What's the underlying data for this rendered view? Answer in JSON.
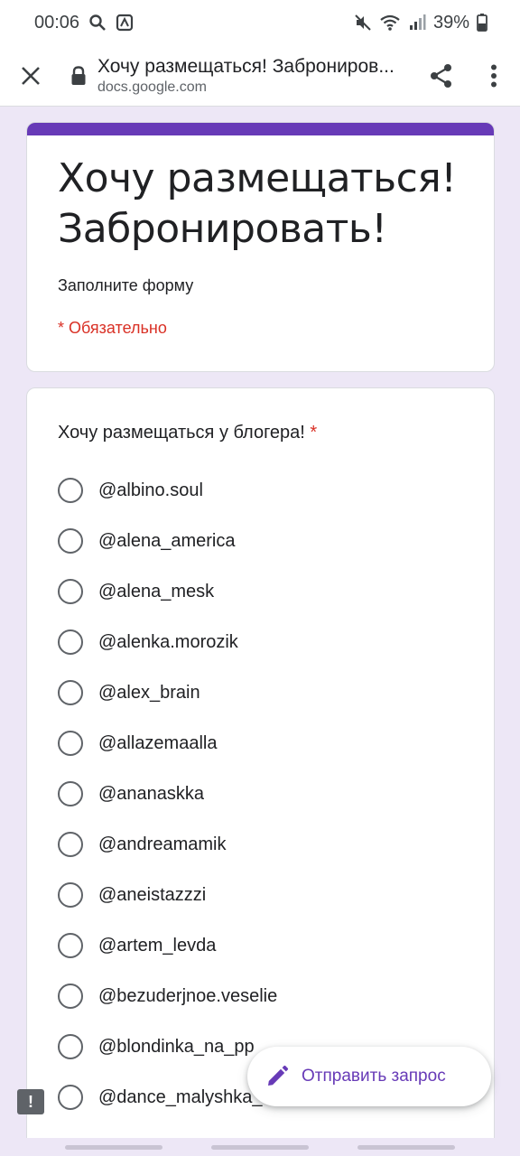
{
  "status_bar": {
    "time": "00:06",
    "battery": "39%",
    "icons": [
      "search-icon",
      "app-notification-icon",
      "mute-icon",
      "wifi-icon",
      "signal-icon",
      "battery-icon"
    ]
  },
  "tab": {
    "title": "Хочу размещаться! Заброниров...",
    "url": "docs.google.com",
    "icons": [
      "close-icon",
      "lock-icon",
      "share-icon",
      "more-vert-icon"
    ]
  },
  "form": {
    "title": "Хочу размещаться! Забронировать!",
    "description": "Заполните форму",
    "required_note": "* Обязательно",
    "accent_color": "#673ab7",
    "question": "Хочу размещаться у блогера!",
    "question_required_mark": "*",
    "options": [
      "@albino.soul",
      "@alena_america",
      "@alena_mesk",
      "@alenka.morozik",
      "@alex_brain",
      "@allazemaalla",
      "@ananaskka",
      "@andreamamik",
      "@aneistazzzi",
      "@artem_levda",
      "@bezuderjnoe.veselie",
      "@blondinka_na_pp",
      "@dance_malyshka_o"
    ]
  },
  "fab": {
    "label": "Отправить запрос",
    "icon": "pencil-icon"
  },
  "feedback": {
    "icon": "feedback-icon"
  },
  "colors": {
    "background": "#ede7f6",
    "accent": "#673ab7",
    "required": "#d93025"
  }
}
